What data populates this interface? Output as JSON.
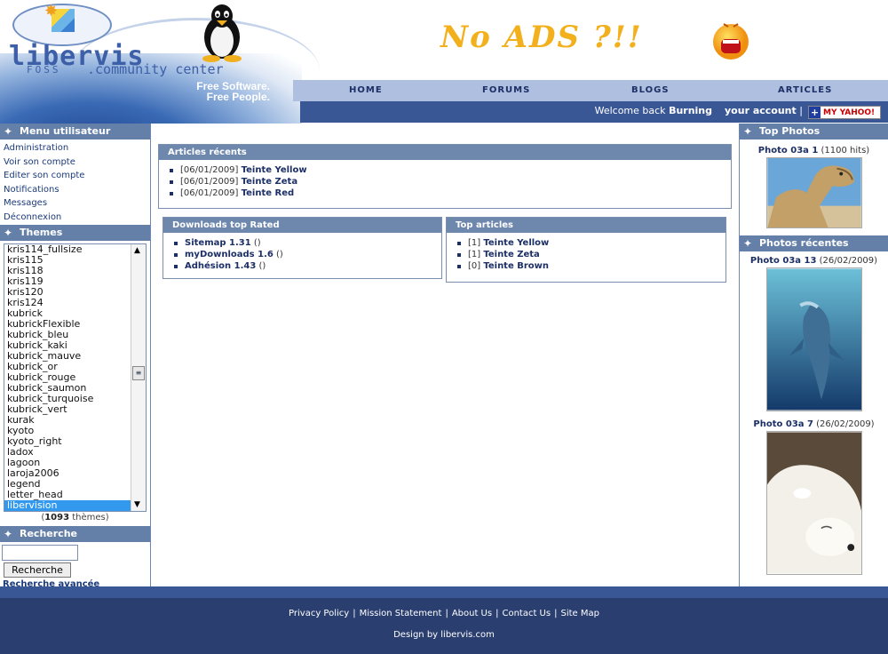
{
  "header": {
    "logo_text": "libervis",
    "logo_foss": "FOSS",
    "logo_subtitle": ".community center",
    "tagline_line1": "Free Software.",
    "tagline_line2": "Free People.",
    "banner_text": "No ADS ?!!"
  },
  "nav": {
    "items": [
      {
        "label": "HOME"
      },
      {
        "label": "FORUMS"
      },
      {
        "label": "BLOGS"
      },
      {
        "label": "ARTICLES"
      }
    ]
  },
  "userbar": {
    "welcome": "Welcome back",
    "username": "Burning",
    "account_link": "your account",
    "separator": "|",
    "myyahoo_label": "MY YAHOO!"
  },
  "left": {
    "menu_title": "Menu utilisateur",
    "menu_items": [
      {
        "label": "Administration"
      },
      {
        "label": "Voir son compte"
      },
      {
        "label": "Editer son compte"
      },
      {
        "label": "Notifications"
      },
      {
        "label": "Messages"
      },
      {
        "label": "Déconnexion"
      }
    ],
    "themes_title": "Themes",
    "themes": [
      "kris114_fullsize",
      "kris115",
      "kris118",
      "kris119",
      "kris120",
      "kris124",
      "kubrick",
      "kubrickFlexible",
      "kubrick_bleu",
      "kubrick_kaki",
      "kubrick_mauve",
      "kubrick_or",
      "kubrick_rouge",
      "kubrick_saumon",
      "kubrick_turquoise",
      "kubrick_vert",
      "kurak",
      "kyoto",
      "kyoto_right",
      "ladox",
      "lagoon",
      "laroja2006",
      "legend",
      "letter_head",
      "libervision"
    ],
    "selected_theme": "libervision",
    "theme_count_open": "(",
    "theme_count": "1093",
    "theme_count_suffix": " thèmes)",
    "search_title": "Recherche",
    "search_value": "",
    "search_button": "Recherche",
    "advanced_search": "Recherche avancée"
  },
  "center": {
    "recent_articles": {
      "title": "Articles récents",
      "items": [
        {
          "date": "[06/01/2009]",
          "name": "Teinte Yellow"
        },
        {
          "date": "[06/01/2009]",
          "name": "Teinte Zeta"
        },
        {
          "date": "[06/01/2009]",
          "name": "Teinte Red"
        }
      ]
    },
    "downloads": {
      "title": "Downloads top Rated",
      "items": [
        {
          "name": "Sitemap 1.31",
          "extra": " ()"
        },
        {
          "name": "myDownloads 1.6",
          "extra": " ()"
        },
        {
          "name": "Adhésion 1.43",
          "extra": " ()"
        }
      ]
    },
    "top_articles": {
      "title": "Top articles",
      "items": [
        {
          "count": "[1]",
          "name": "Teinte Yellow"
        },
        {
          "count": "[1]",
          "name": "Teinte Zeta"
        },
        {
          "count": "[0]",
          "name": "Teinte Brown"
        }
      ]
    }
  },
  "right": {
    "top_photos_title": "Top Photos",
    "top_photo": {
      "name": "Photo 03a 1",
      "meta": " (1100 hits)"
    },
    "recent_photos_title": "Photos récentes",
    "recent_photos": [
      {
        "name": "Photo 03a 13",
        "meta": " (26/02/2009)"
      },
      {
        "name": "Photo 03a 7",
        "meta": " (26/02/2009)"
      }
    ]
  },
  "footer": {
    "links": [
      {
        "label": "Privacy Policy"
      },
      {
        "label": "Mission Statement"
      },
      {
        "label": "About Us"
      },
      {
        "label": "Contact Us"
      },
      {
        "label": "Site Map"
      }
    ],
    "separator": "|",
    "credit": "Design by libervis.com"
  },
  "colors": {
    "nav_bg": "#aebfdf",
    "userbar_bg": "#3a5795",
    "block_title_bg": "#6580a8",
    "footer_bg": "#2a3e70",
    "banner_orange": "#f1b01c",
    "selected_theme": "#3399ee"
  }
}
